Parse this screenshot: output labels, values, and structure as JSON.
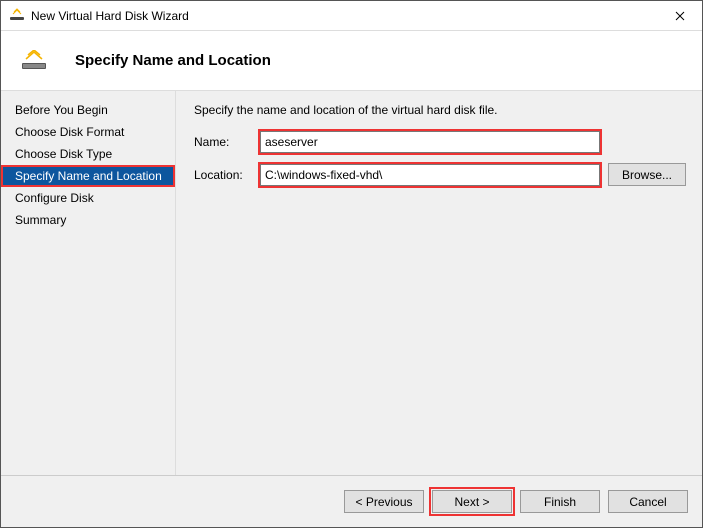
{
  "window": {
    "title": "New Virtual Hard Disk Wizard"
  },
  "header": {
    "title": "Specify Name and Location"
  },
  "sidebar": {
    "steps": [
      {
        "label": "Before You Begin"
      },
      {
        "label": "Choose Disk Format"
      },
      {
        "label": "Choose Disk Type"
      },
      {
        "label": "Specify Name and Location",
        "active": true,
        "highlight": true
      },
      {
        "label": "Configure Disk"
      },
      {
        "label": "Summary"
      }
    ]
  },
  "content": {
    "instruction": "Specify the name and location of the virtual hard disk file.",
    "name_label": "Name:",
    "name_value": "aseserver",
    "location_label": "Location:",
    "location_value": "C:\\windows-fixed-vhd\\",
    "browse_label": "Browse..."
  },
  "footer": {
    "previous": "< Previous",
    "next": "Next >",
    "finish": "Finish",
    "cancel": "Cancel"
  }
}
